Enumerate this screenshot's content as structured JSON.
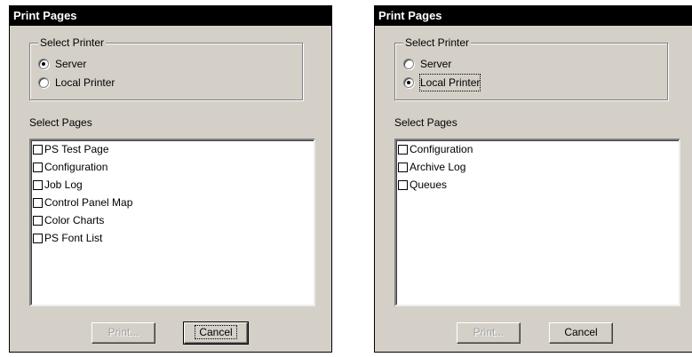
{
  "dialogs": [
    {
      "title": "Print Pages",
      "printer_group_label": "Select Printer",
      "printer_options": [
        {
          "label": "Server",
          "selected": true
        },
        {
          "label": "Local Printer",
          "selected": false
        }
      ],
      "pages_label": "Select Pages",
      "pages": [
        "PS Test Page",
        "Configuration",
        "Job Log",
        "Control Panel Map",
        "Color Charts",
        "PS Font List"
      ],
      "print_button": "Print...",
      "cancel_button": "Cancel"
    },
    {
      "title": "Print Pages",
      "printer_group_label": "Select Printer",
      "printer_options": [
        {
          "label": "Server",
          "selected": false
        },
        {
          "label": "Local Printer",
          "selected": true
        }
      ],
      "pages_label": "Select Pages",
      "pages": [
        "Configuration",
        "Archive Log",
        "Queues"
      ],
      "print_button": "Print...",
      "cancel_button": "Cancel"
    }
  ]
}
